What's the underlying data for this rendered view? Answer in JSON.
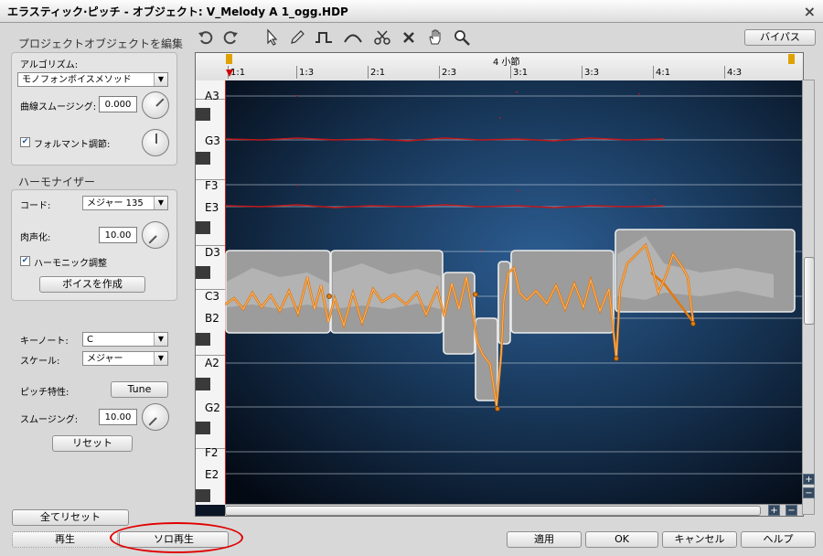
{
  "window": {
    "title": "エラスティック·ピッチ - オブジェクト: V_Melody A 1_ogg.HDP",
    "close_glyph": "×"
  },
  "project_section": {
    "heading": "プロジェクトオブジェクトを編集",
    "algorithm_label": "アルゴリズム:",
    "algorithm_value": "モノフォンボイスメソッド",
    "curve_smoothing_label": "曲線スムージング:",
    "curve_smoothing_value": "0.000",
    "formant_label": "フォルマント調節:",
    "formant_checked": true
  },
  "harmonizer": {
    "heading": "ハーモナイザー",
    "chord_label": "コード:",
    "chord_value": "メジャー 135",
    "humanize_label": "肉声化:",
    "humanize_value": "10.00",
    "harmonic_label": "ハーモニック調整",
    "harmonic_checked": true,
    "create_voice_button": "ボイスを作成"
  },
  "key_section": {
    "key_note_label": "キーノート:",
    "key_note_value": "C",
    "scale_label": "スケール:",
    "scale_value": "メジャー",
    "pitch_char_label": "ピッチ特性:",
    "tune_button": "Tune",
    "smoothing_label": "スムージング:",
    "smoothing_value": "10.00",
    "reset_button": "リセット"
  },
  "bottom": {
    "reset_all": "全てリセット",
    "play": "再生",
    "solo_play": "ソロ再生",
    "apply": "適用",
    "ok": "OK",
    "cancel": "キャンセル",
    "help": "ヘルプ"
  },
  "toolbar": {
    "bypass": "バイパス",
    "tools": [
      "undo-icon",
      "redo-icon",
      "pointer-icon",
      "pencil-icon",
      "pulse-icon",
      "curve-icon",
      "scissors-icon",
      "erase-icon",
      "hand-icon",
      "zoom-icon"
    ]
  },
  "ruler": {
    "center_label": "4 小節",
    "ticks": [
      "1:1",
      "1:3",
      "2:1",
      "2:3",
      "3:1",
      "3:3",
      "4:1",
      "4:3"
    ]
  },
  "piano": {
    "labels": [
      "A3",
      "G3",
      "F3",
      "E3",
      "D3",
      "C3",
      "B2",
      "A2",
      "G2",
      "F2",
      "E2"
    ]
  },
  "zoom": {
    "plus": "+",
    "minus": "−"
  },
  "colors": {
    "note_block": "#9c9c9c",
    "pitch_curve": "#e07a10",
    "harmony_line": "#c2191b",
    "annotation": "#e00000"
  }
}
